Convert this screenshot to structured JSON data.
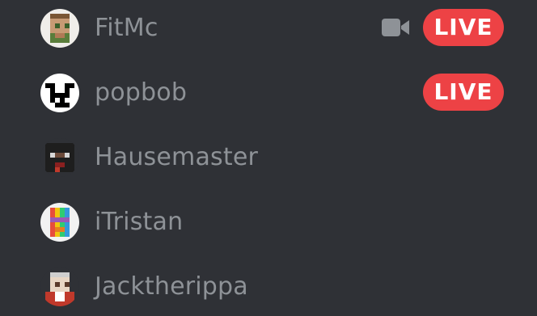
{
  "colors": {
    "background": "#2f3136",
    "name_text": "#8e9297",
    "live_badge": "#ed4245",
    "live_text": "#ffffff",
    "camera_icon": "#8e9297"
  },
  "members": [
    {
      "name": "FitMc",
      "streaming_icon": "camera-icon",
      "live_label": "LIVE"
    },
    {
      "name": "popbob",
      "live_label": "LIVE"
    },
    {
      "name": "Hausemaster"
    },
    {
      "name": "iTristan"
    },
    {
      "name": "Jacktherippa"
    }
  ]
}
